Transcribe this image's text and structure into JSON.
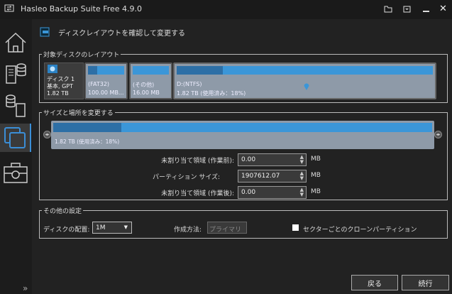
{
  "app": {
    "title": "Hasleo Backup Suite Free 4.9.0",
    "icons": [
      "open-folder-icon",
      "tray-icon",
      "minimize-icon",
      "close-icon"
    ]
  },
  "sidebar": {
    "items": [
      "home",
      "backup",
      "restore",
      "clone",
      "tools"
    ],
    "expand": "»"
  },
  "header": {
    "title": "ディスクレイアウトを確認して変更する"
  },
  "layout_group": {
    "title": "対象ディスクのレイアウト",
    "disk": {
      "name": "ディスク 1",
      "type": "基本, GPT",
      "size": "1.82 TB"
    },
    "partitions": [
      {
        "label": "(FAT32)",
        "size": "100.00 MB...",
        "used_pct": 25
      },
      {
        "label": "(その他)",
        "size": "16.00 MB",
        "used_pct": 0
      },
      {
        "label": "D:(NTFS)",
        "size": "1.82 TB (使用済み：18%)",
        "used_pct": 18
      }
    ]
  },
  "resize_group": {
    "title": "サイズと場所を変更する",
    "bar_text": "1.82 TB (使用済み：18%)",
    "used_pct": 18,
    "fields": [
      {
        "label": "未割り当て領域 (作業前):",
        "value": "0.00",
        "unit": "MB"
      },
      {
        "label": "パーティション サイズ:",
        "value": "1907612.07",
        "unit": "MB"
      },
      {
        "label": "未割り当て領域 (作業後):",
        "value": "0.00",
        "unit": "MB"
      }
    ]
  },
  "other_group": {
    "title": "その他の設定",
    "align_label": "ディスクの配置:",
    "align_value": "1M",
    "method_label": "作成方法:",
    "method_value": "プライマリ",
    "clone_label": "セクターごとのクローンパーティション",
    "clone_checked": false
  },
  "buttons": {
    "back": "戻る",
    "next": "続行"
  }
}
